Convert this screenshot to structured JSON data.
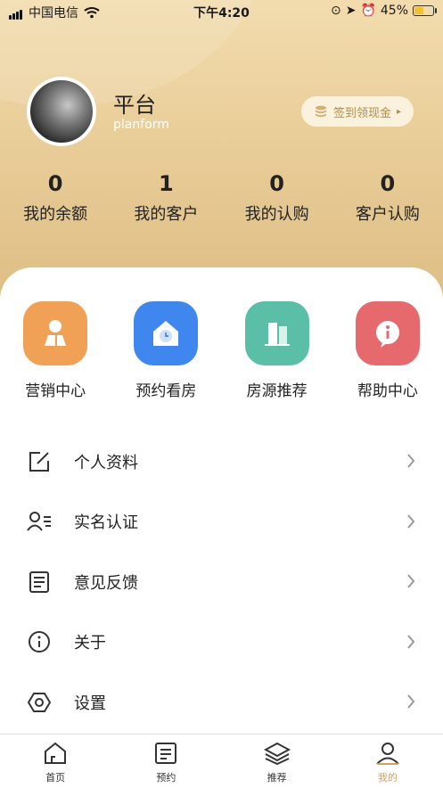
{
  "status_bar": {
    "carrier": "中国电信",
    "time": "下午4:20",
    "battery": "45%"
  },
  "profile": {
    "name": "平台",
    "username": "planform",
    "checkin_label": "签到领现金"
  },
  "stats": [
    {
      "value": "0",
      "label": "我的余额"
    },
    {
      "value": "1",
      "label": "我的客户"
    },
    {
      "value": "0",
      "label": "我的认购"
    },
    {
      "value": "0",
      "label": "客户认购"
    }
  ],
  "quick_actions": [
    {
      "label": "营销中心",
      "color": "#f0a155"
    },
    {
      "label": "预约看房",
      "color": "#3f87ee"
    },
    {
      "label": "房源推荐",
      "color": "#5bbfa8"
    },
    {
      "label": "帮助中心",
      "color": "#e6696d"
    }
  ],
  "menu": [
    {
      "label": "个人资料",
      "icon": "edit-icon"
    },
    {
      "label": "实名认证",
      "icon": "id-verify-icon"
    },
    {
      "label": "意见反馈",
      "icon": "feedback-icon"
    },
    {
      "label": "关于",
      "icon": "info-icon"
    },
    {
      "label": "设置",
      "icon": "settings-icon"
    }
  ],
  "tabs": [
    {
      "label": "首页",
      "icon": "home-icon"
    },
    {
      "label": "预约",
      "icon": "appointment-icon"
    },
    {
      "label": "推荐",
      "icon": "layers-icon"
    },
    {
      "label": "我的",
      "icon": "user-icon",
      "active": true
    }
  ],
  "colors": {
    "header_gold": "#e9cd98",
    "active_tab": "#c9a36b"
  }
}
